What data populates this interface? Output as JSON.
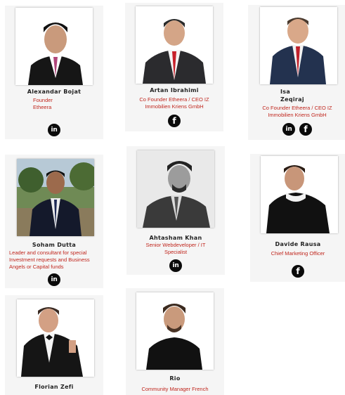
{
  "team": [
    {
      "name": "Alexandar Bojat",
      "role": "Founder\nEtheera",
      "icons": [
        "linkedin-icon"
      ]
    },
    {
      "name": "Artan Ibrahimi",
      "role": "Co Founder Etheera / CEO IZ\nImmobilien Kriens GmbH",
      "icons": [
        "facebook-icon"
      ]
    },
    {
      "name": "Isa\nZeqiraj",
      "role": "Co Founder Etheera / CEO IZ\nImmobilien Kriens GmbH",
      "icons": [
        "linkedin-icon",
        "facebook-icon"
      ]
    },
    {
      "name": "Soham Dutta",
      "role": "Leader and consultant for special\nInvestment requests and Business\nAngels or Capital funds",
      "icons": [
        "linkedin-icon"
      ]
    },
    {
      "name": "Ahtasham Khan",
      "role": "Senior Webdeveloper  / IT\nSpecialist",
      "icons": [
        "linkedin-icon"
      ]
    },
    {
      "name": "Davide Rausa",
      "role": "Chief Marketing Officer",
      "icons": [
        "facebook-icon"
      ]
    },
    {
      "name": "Florian Zefi",
      "role": "",
      "icons": []
    },
    {
      "name": "Rio",
      "role": "Community Manager French",
      "icons": []
    }
  ],
  "icon_glyphs": {
    "linkedin-icon": "in",
    "facebook-icon": "f"
  }
}
